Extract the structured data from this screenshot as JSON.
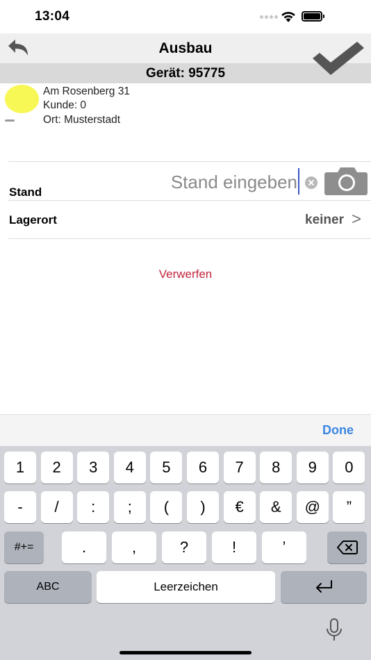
{
  "status_bar": {
    "time": "13:04"
  },
  "nav": {
    "title": "Ausbau",
    "device": "Gerät: 95775"
  },
  "customer": {
    "street": "Am Rosenberg 31",
    "customer_line": "Kunde: 0",
    "city_line": "Ort: Musterstadt",
    "status_color": "#f7f755"
  },
  "form": {
    "stand_label": "Stand",
    "stand_placeholder": "Stand eingeben",
    "stand_value": "",
    "lagerort_label": "Lagerort",
    "lagerort_value": "keiner",
    "chevron": ">"
  },
  "actions": {
    "discard": "Verwerfen",
    "discard_color": "#c0233d"
  },
  "keyboard": {
    "done": "Done",
    "row1": [
      "1",
      "2",
      "3",
      "4",
      "5",
      "6",
      "7",
      "8",
      "9",
      "0"
    ],
    "row2": [
      "-",
      "/",
      ":",
      ";",
      "(",
      ")",
      "€",
      "&",
      "@",
      "”"
    ],
    "row3": [
      ".",
      ",",
      "?",
      "!",
      "’"
    ],
    "symbols_key": "#+=",
    "abc_key": "ABC",
    "space_key": "Leerzeichen"
  },
  "icons": [
    "back-arrow-icon",
    "checkmark-icon",
    "camera-icon",
    "clear-icon",
    "backspace-icon",
    "return-icon",
    "microphone-icon",
    "wifi-icon",
    "battery-icon"
  ]
}
